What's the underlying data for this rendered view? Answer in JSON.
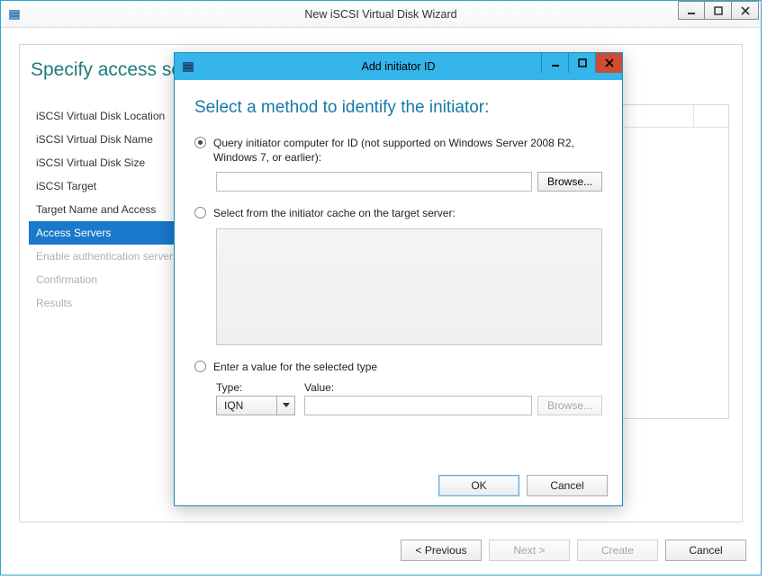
{
  "wizard": {
    "title": "New iSCSI Virtual Disk Wizard",
    "heading": "Specify access servers",
    "steps": [
      {
        "label": "iSCSI Virtual Disk Location",
        "state": "done"
      },
      {
        "label": "iSCSI Virtual Disk Name",
        "state": "done"
      },
      {
        "label": "iSCSI Virtual Disk Size",
        "state": "done"
      },
      {
        "label": "iSCSI Target",
        "state": "done"
      },
      {
        "label": "Target Name and Access",
        "state": "done"
      },
      {
        "label": "Access Servers",
        "state": "active"
      },
      {
        "label": "Enable authentication servers",
        "state": "disabled"
      },
      {
        "label": "Confirmation",
        "state": "disabled"
      },
      {
        "label": "Results",
        "state": "disabled"
      }
    ],
    "footer": {
      "previous": "< Previous",
      "next": "Next >",
      "create": "Create",
      "cancel": "Cancel"
    }
  },
  "dialog": {
    "title": "Add initiator ID",
    "heading": "Select a method to identify the initiator:",
    "opt_query": "Query initiator computer for ID (not supported on Windows Server 2008 R2, Windows 7, or earlier):",
    "browse": "Browse...",
    "opt_cache": "Select from the initiator cache on the target server:",
    "opt_manual": "Enter a value for the selected type",
    "type_label": "Type:",
    "value_label": "Value:",
    "type_selected": "IQN",
    "ok": "OK",
    "cancel": "Cancel",
    "selected_option": "query"
  }
}
